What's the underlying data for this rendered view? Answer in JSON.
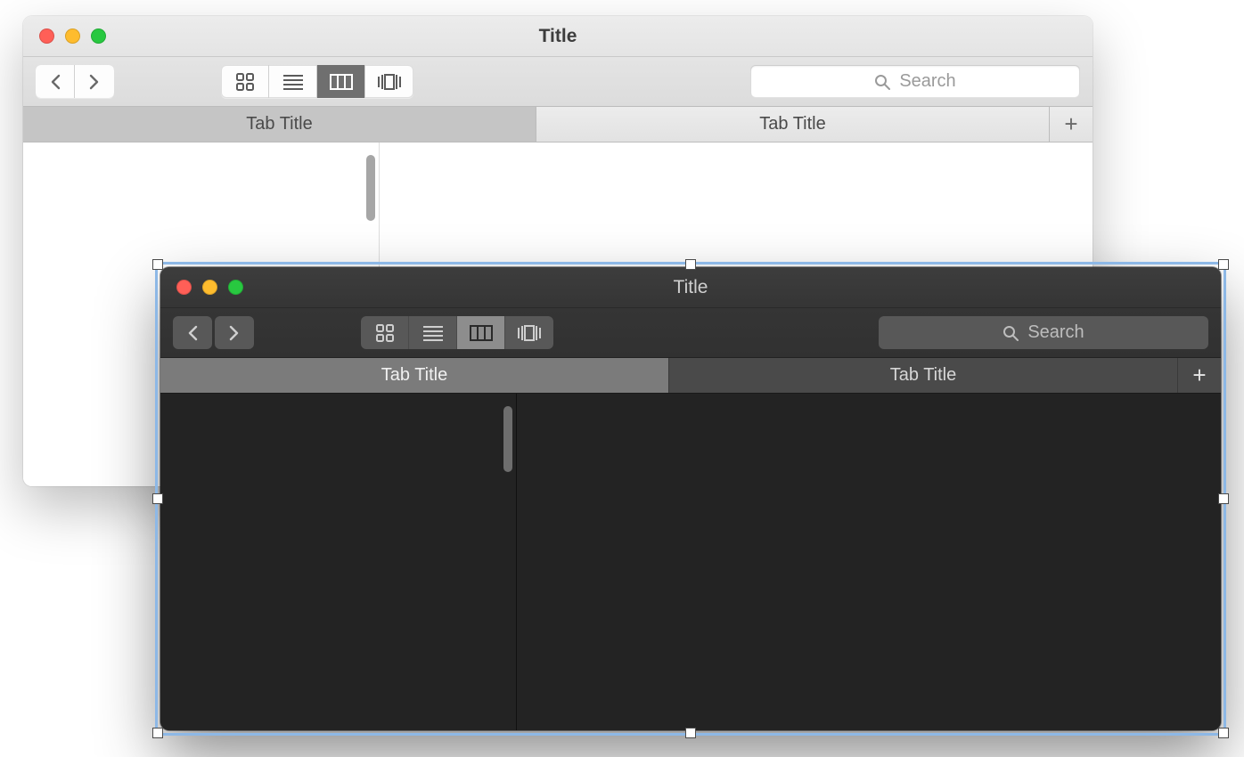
{
  "light": {
    "title": "Title",
    "search_placeholder": "Search",
    "tabs": [
      {
        "label": "Tab Title",
        "active": true
      },
      {
        "label": "Tab Title",
        "active": false
      }
    ]
  },
  "dark": {
    "title": "Title",
    "search_placeholder": "Search",
    "tabs": [
      {
        "label": "Tab Title",
        "active": true
      },
      {
        "label": "Tab Title",
        "active": false
      }
    ]
  },
  "icons": {
    "add": "+"
  }
}
